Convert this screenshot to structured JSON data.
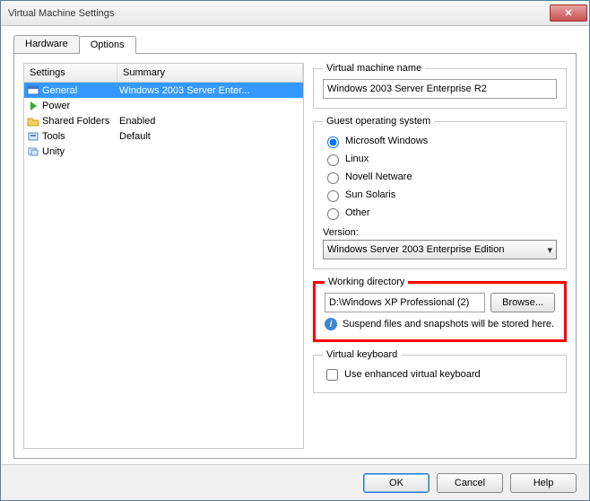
{
  "window": {
    "title": "Virtual Machine Settings"
  },
  "tabs": {
    "hardware": "Hardware",
    "options": "Options"
  },
  "columns": {
    "settings": "Settings",
    "summary": "Summary"
  },
  "settings_list": [
    {
      "label": "General",
      "summary": "Windows 2003 Server Enter..."
    },
    {
      "label": "Power",
      "summary": ""
    },
    {
      "label": "Shared Folders",
      "summary": "Enabled"
    },
    {
      "label": "Tools",
      "summary": "Default"
    },
    {
      "label": "Unity",
      "summary": ""
    }
  ],
  "vm_name": {
    "legend": "Virtual machine name",
    "value": "Windows 2003 Server Enterprise R2"
  },
  "guest_os": {
    "legend": "Guest operating system",
    "options": {
      "windows": "Microsoft Windows",
      "linux": "Linux",
      "novell": "Novell Netware",
      "solaris": "Sun Solaris",
      "other": "Other"
    },
    "version_label": "Version:",
    "version_value": "Windows Server 2003 Enterprise Edition"
  },
  "workdir": {
    "legend": "Working directory",
    "path": "D:\\Windows XP Professional (2)",
    "browse": "Browse...",
    "info": "Suspend files and snapshots will be stored here."
  },
  "vkb": {
    "legend": "Virtual keyboard",
    "label": "Use enhanced virtual keyboard"
  },
  "buttons": {
    "ok": "OK",
    "cancel": "Cancel",
    "help": "Help"
  }
}
